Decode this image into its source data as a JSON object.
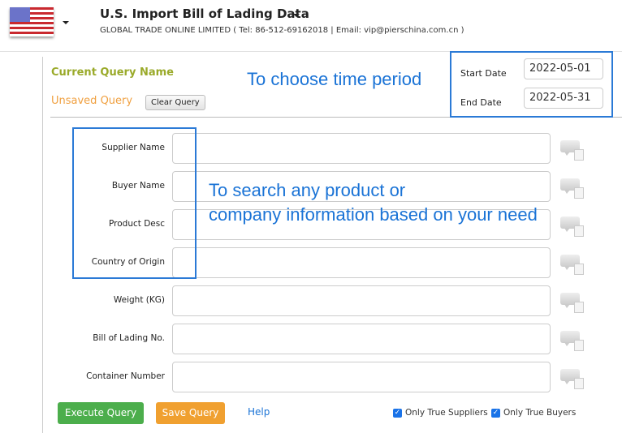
{
  "header": {
    "title": "U.S. Import Bill of Lading Data",
    "subtitle": "GLOBAL TRADE ONLINE LIMITED ( Tel: 86-512-69162018 | Email: vip@pierschina.com.cn )",
    "flag_icon": "us-flag-icon"
  },
  "query": {
    "current_label": "Current Query Name",
    "name": "Unsaved Query",
    "clear_label": "Clear Query"
  },
  "dates": {
    "start_label": "Start Date",
    "start_value": "2022-05-01",
    "end_label": "End Date",
    "end_value": "2022-05-31"
  },
  "annotations": {
    "time": "To choose time period",
    "search_line1": "To search any product or",
    "search_line2": "company information based on your need",
    "color": "#2b7ad6"
  },
  "fields": [
    {
      "label": "Supplier Name",
      "value": ""
    },
    {
      "label": "Buyer Name",
      "value": ""
    },
    {
      "label": "Product Desc",
      "value": ""
    },
    {
      "label": "Country of Origin",
      "value": ""
    },
    {
      "label": "Weight (KG)",
      "value": ""
    },
    {
      "label": "Bill of Lading No.",
      "value": ""
    },
    {
      "label": "Container Number",
      "value": ""
    }
  ],
  "actions": {
    "execute": "Execute Query",
    "save": "Save Query",
    "help": "Help",
    "execute_color": "#4cae4c",
    "save_color": "#f0a030"
  },
  "options": [
    {
      "label": "Only True Suppliers",
      "checked": true
    },
    {
      "label": "Only True Buyers",
      "checked": true
    }
  ]
}
